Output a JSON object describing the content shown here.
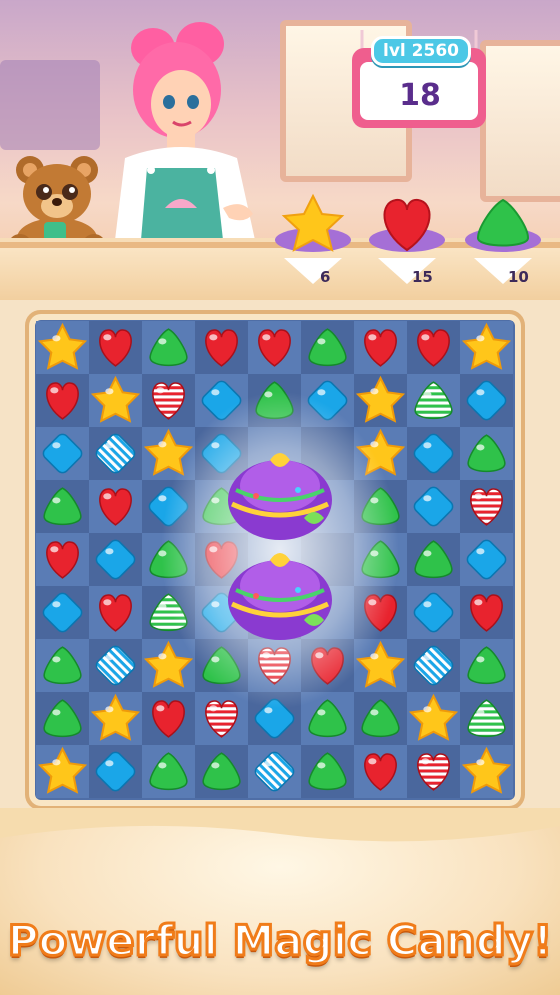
{
  "level": {
    "label": "lvl 2560"
  },
  "moves": {
    "value": "18"
  },
  "goals": [
    {
      "candy": "yellow-star",
      "count": "6"
    },
    {
      "candy": "red-heart",
      "count": "15"
    },
    {
      "candy": "green-drop",
      "count": "10"
    }
  ],
  "board": {
    "rows": 9,
    "cols": 9,
    "grid": [
      [
        "star",
        "heart",
        "green",
        "heart",
        "heart",
        "green",
        "heart",
        "heart",
        "star"
      ],
      [
        "heart",
        "star",
        "stripe-heart",
        "blue",
        "green",
        "blue",
        "star",
        "stripe-green",
        "blue"
      ],
      [
        "blue",
        "stripe-blue",
        "star",
        "blue",
        "cake",
        "cake",
        "star",
        "blue",
        "green"
      ],
      [
        "green",
        "heart",
        "blue",
        "green",
        "cake",
        "cake",
        "green",
        "blue",
        "stripe-heart"
      ],
      [
        "heart",
        "blue",
        "green",
        "heart",
        "cake",
        "cake",
        "green",
        "green",
        "blue"
      ],
      [
        "blue",
        "heart",
        "stripe-green",
        "blue",
        "cake",
        "cake",
        "heart",
        "blue",
        "heart"
      ],
      [
        "green",
        "stripe-blue",
        "star",
        "green",
        "stripe-heart",
        "heart",
        "star",
        "stripe-blue",
        "green"
      ],
      [
        "green",
        "star",
        "heart",
        "stripe-heart",
        "blue",
        "green",
        "green",
        "star",
        "stripe-green"
      ],
      [
        "star",
        "blue",
        "green",
        "green",
        "stripe-blue",
        "green",
        "heart",
        "stripe-heart",
        "star"
      ]
    ]
  },
  "colors": {
    "heart": "#e8232e",
    "green": "#2fc24a",
    "blue": "#1aa6e8",
    "star": "#ffc61a",
    "board": "#4f6ea6",
    "tagline_stroke": "#f07c1a"
  },
  "tagline": {
    "text": "Powerful Magic Candy!"
  }
}
